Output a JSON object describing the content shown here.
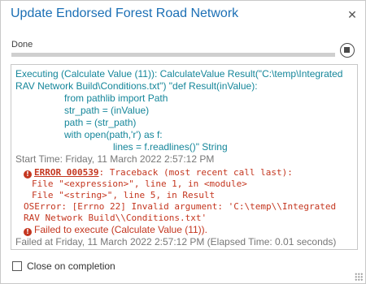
{
  "window": {
    "title": "Update Endorsed Forest Road Network",
    "close_symbol": "✕"
  },
  "progress": {
    "status": "Done",
    "percent": 100
  },
  "messages": {
    "executing_line1": "Executing (Calculate Value (11)): CalculateValue Result(\"C:\\temp\\Integrated",
    "executing_line2": "RAV Network Build\\Conditions.txt\") \"def Result(inValue):",
    "code_lines": [
      "from pathlib import Path",
      "str_path = (inValue)",
      "path = (str_path)",
      "with open(path,'r') as f:",
      "lines = f.readlines()\" String"
    ],
    "start_time": "Start Time: Friday, 11 March 2022 2:57:12 PM",
    "error_code": "ERROR 000539",
    "error_head": ": Traceback (most recent call last):",
    "error_lines": [
      "File \"<expression>\", line 1, in <module>",
      "File \"<string>\", line 5, in Result"
    ],
    "os_error_line1": "OSError: [Errno 22] Invalid argument: 'C:\\temp\\\\Integrated",
    "os_error_line2": "RAV Network Build\\\\Conditions.txt'",
    "failed_execute": "Failed to execute (Calculate Value (11)).",
    "failed_at": "Failed at Friday, 11 March 2022 2:57:12 PM (Elapsed Time: 0.01 seconds)"
  },
  "footer": {
    "close_on_completion_label": "Close on completion",
    "close_on_completion_checked": false
  },
  "colors": {
    "title": "#1b6fb5",
    "message_teal": "#15869a",
    "error_red": "#c4361f",
    "muted_gray": "#777777"
  },
  "icons": {
    "close": "close-icon",
    "stop": "stop-icon",
    "error": "error-icon",
    "resize": "resize-grip-icon"
  }
}
